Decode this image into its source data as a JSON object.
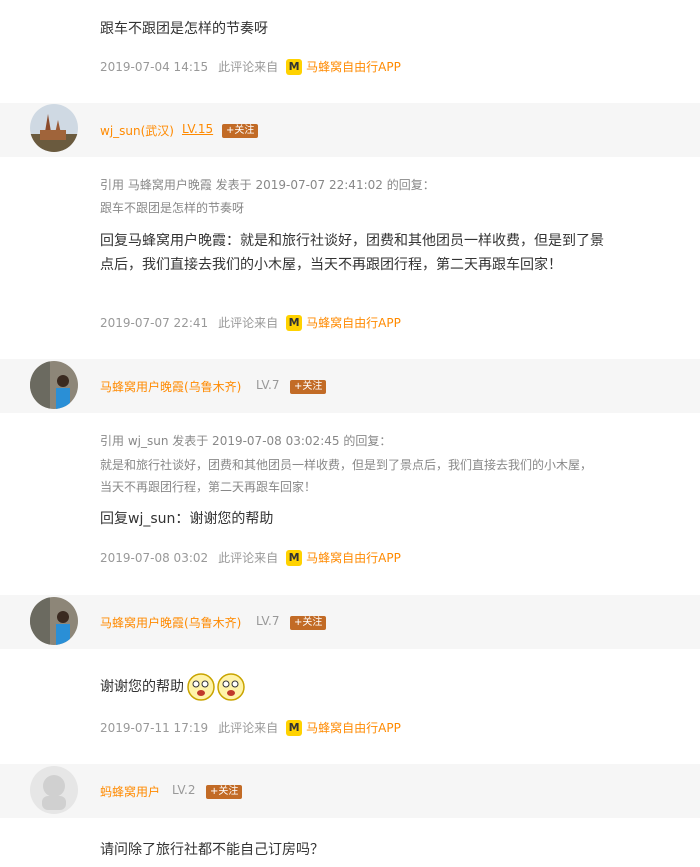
{
  "comments": [
    {
      "text": "跟车不跟团是怎样的节奏呀",
      "time": "2019-07-04 14:15",
      "source_label": "此评论来自",
      "app_name": "马蜂窝自由行APP"
    },
    {
      "user": "wj_sun(武汉)",
      "level": "LV.15",
      "follow": "+关注",
      "quote_head": "引用 马蜂窝用户晚霞 发表于 2019-07-07 22:41:02 的回复：",
      "quote_body": "跟车不跟团是怎样的节奏呀",
      "reply": "回复马蜂窝用户晚霞：就是和旅行社谈好，团费和其他团员一样收费，但是到了景点后，我们直接去我们的小木屋，当天不再跟团行程，第二天再跟车回家！",
      "time": "2019-07-07 22:41",
      "source_label": "此评论来自",
      "app_name": "马蜂窝自由行APP"
    },
    {
      "user": "马蜂窝用户晚霞(乌鲁木齐)",
      "level": "LV.7",
      "follow": "+关注",
      "quote_head": "引用 wj_sun 发表于 2019-07-08 03:02:45 的回复：",
      "quote_body": "就是和旅行社谈好，团费和其他团员一样收费，但是到了景点后，我们直接去我们的小木屋，当天不再跟团行程，第二天再跟车回家！",
      "reply": "回复wj_sun：谢谢您的帮助",
      "time": "2019-07-08 03:02",
      "source_label": "此评论来自",
      "app_name": "马蜂窝自由行APP"
    },
    {
      "user": "马蜂窝用户晚霞(乌鲁木齐)",
      "level": "LV.7",
      "follow": "+关注",
      "reply": "谢谢您的帮助",
      "time": "2019-07-11 17:19",
      "source_label": "此评论来自",
      "app_name": "马蜂窝自由行APP"
    },
    {
      "user": "蚂蜂窝用户",
      "level": "LV.2",
      "follow": "+关注",
      "reply": "请问除了旅行社都不能自己订房吗？"
    }
  ],
  "icons": {
    "app_logo": "mafengwo-logo-icon",
    "emoji": "laughing-face-emoji"
  },
  "colors": {
    "accent": "#ff8a00",
    "follow_bg": "#c26b26",
    "app_yellow": "#ffd200"
  }
}
